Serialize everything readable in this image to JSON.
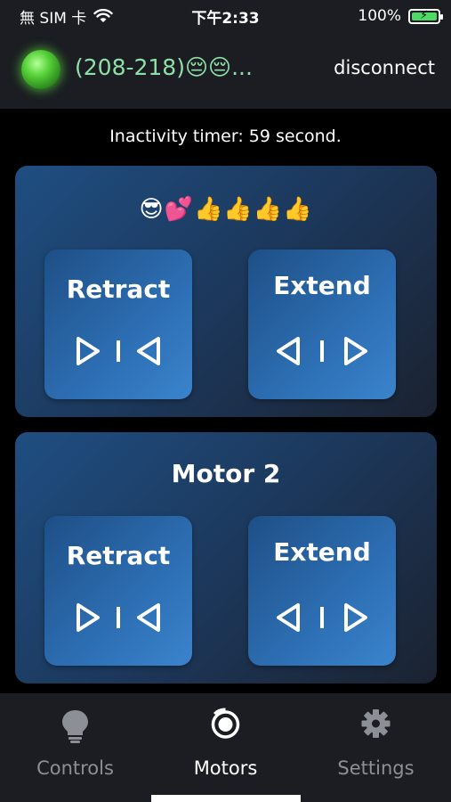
{
  "status_bar": {
    "carrier": "無 SIM 卡",
    "time": "下午2:33",
    "battery": "100%"
  },
  "header": {
    "device_title": "(208-218)😔😔...",
    "disconnect_label": "disconnect",
    "status_led_color": "#58d33a"
  },
  "timer_text": "Inactivity timer: 59 second.",
  "motors": [
    {
      "title": "😎💕👍👍👍👍",
      "retract_label": "Retract",
      "extend_label": "Extend"
    },
    {
      "title": "Motor 2",
      "retract_label": "Retract",
      "extend_label": "Extend"
    }
  ],
  "tabs": [
    {
      "label": "Controls",
      "icon": "lightbulb-icon",
      "active": false
    },
    {
      "label": "Motors",
      "icon": "motor-icon",
      "active": true
    },
    {
      "label": "Settings",
      "icon": "gear-icon",
      "active": false
    }
  ],
  "colors": {
    "accent_blue": "#2d6fb4",
    "led_green": "#58d33a",
    "title_green": "#8ee0a8"
  }
}
